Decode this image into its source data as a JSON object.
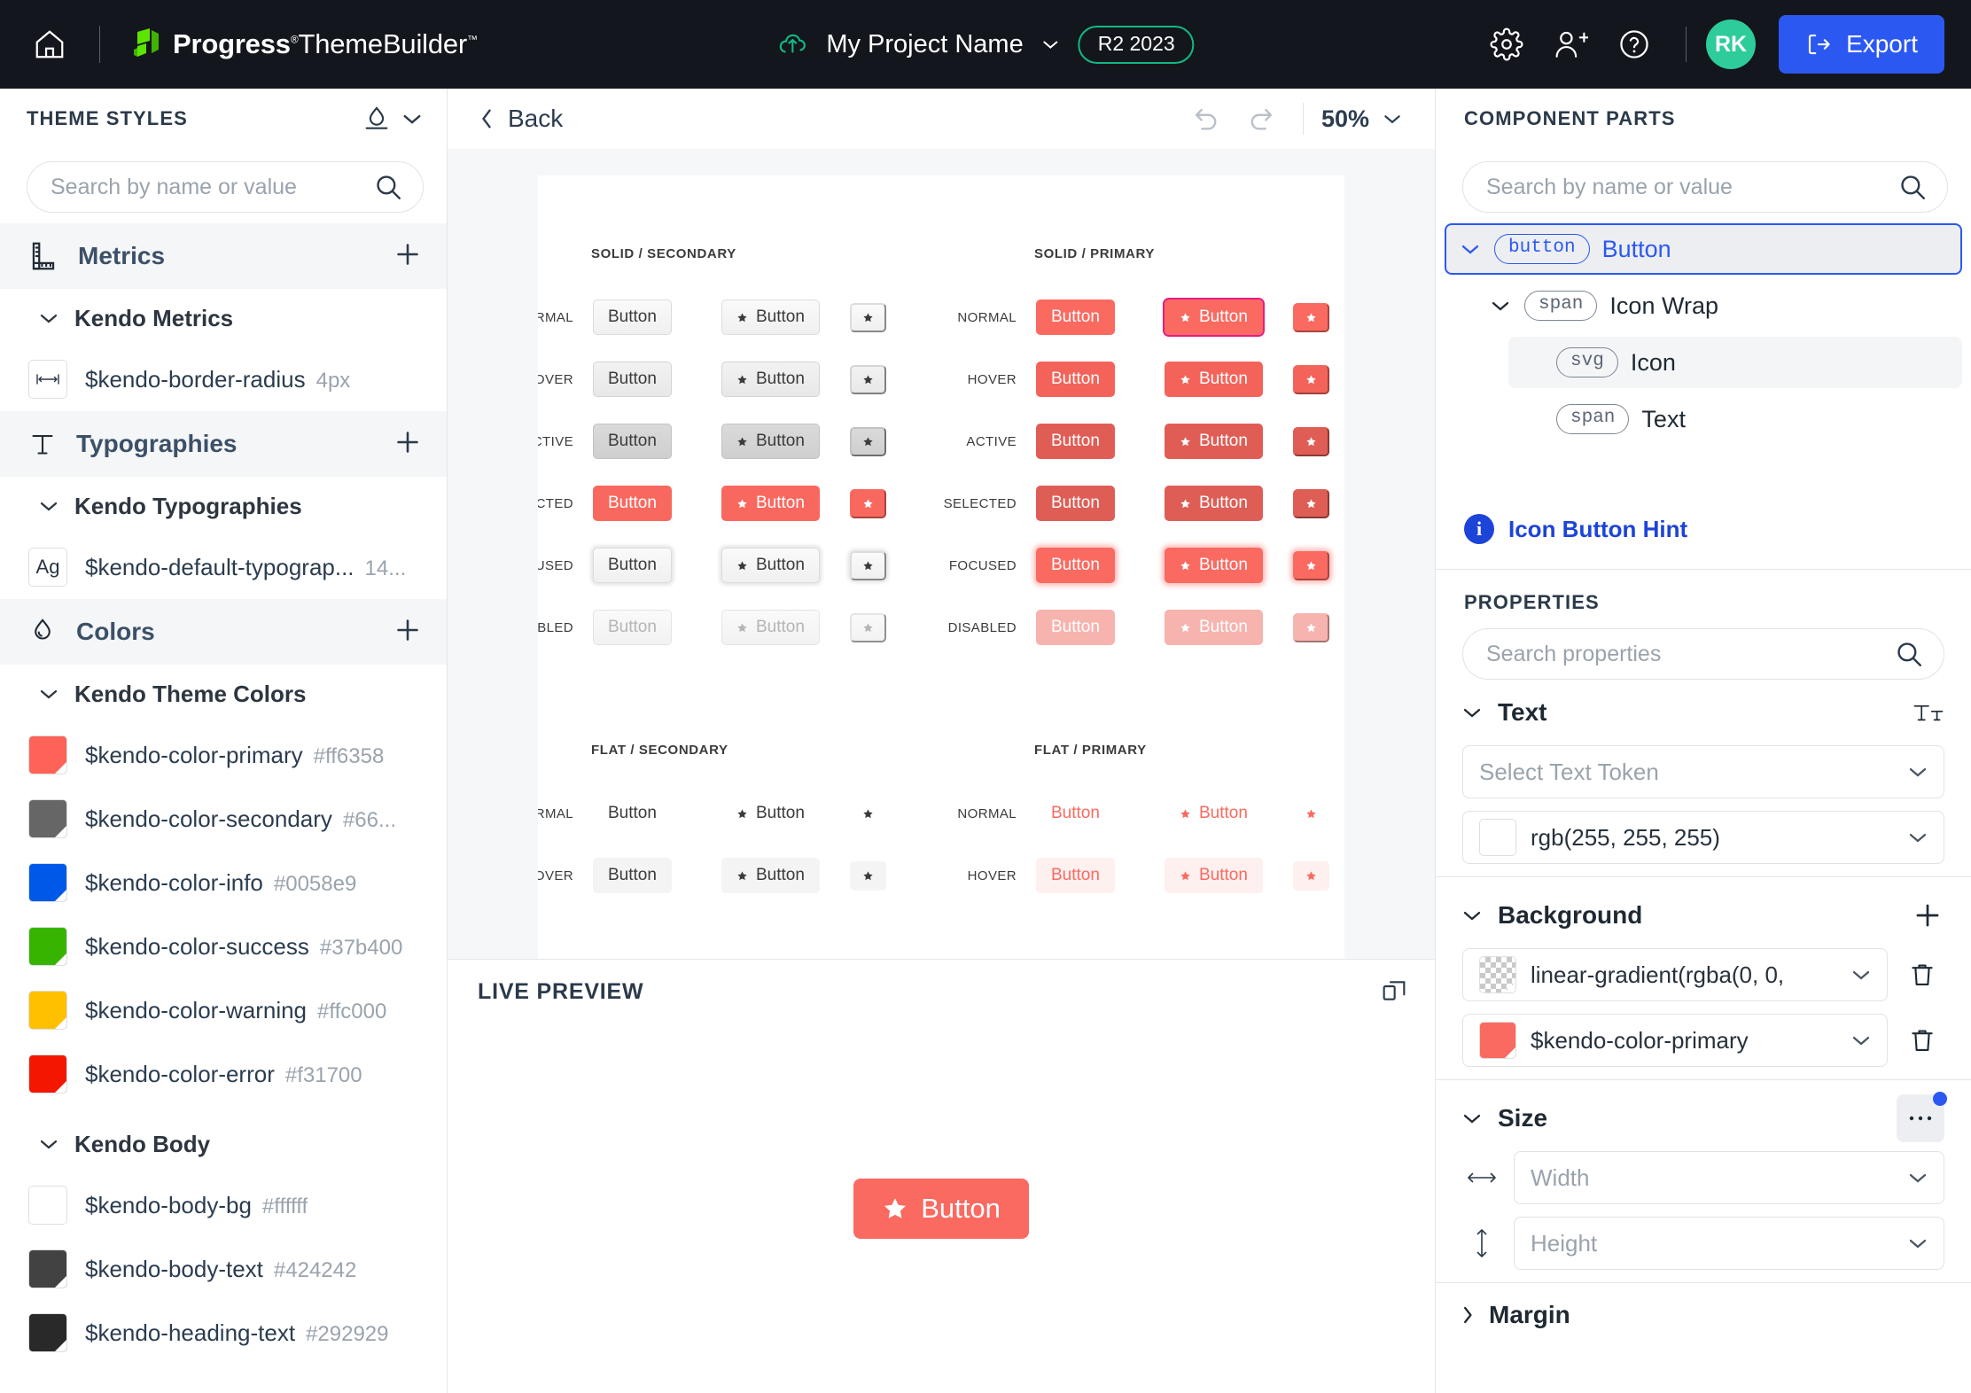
{
  "topbar": {
    "home_icon": "home-icon",
    "brand_progress": "Progress",
    "brand_theme": "ThemeBuilder",
    "project_name": "My Project Name",
    "release_badge": "R2 2023",
    "settings_icon": "gear-icon",
    "invite_icon": "add-user-icon",
    "help_icon": "help-icon",
    "avatar_initials": "RK",
    "export_label": "Export",
    "accent_blue": "#2c58f2",
    "accent_green": "#12b886",
    "avatar_bg": "#2ecc9b"
  },
  "left_panel": {
    "title": "THEME STYLES",
    "search_placeholder": "Search by name or value",
    "categories": [
      {
        "label": "Metrics",
        "icon": "ruler-icon"
      },
      {
        "label": "Typographies",
        "icon": "type-icon"
      },
      {
        "label": "Colors",
        "icon": "droplet-icon"
      }
    ],
    "groups": {
      "metrics": "Kendo Metrics",
      "typographies": "Kendo Typographies",
      "theme_colors": "Kendo Theme Colors",
      "body": "Kendo Body"
    },
    "metric_tokens": [
      {
        "name": "$kendo-border-radius",
        "value": "4px",
        "icon": "width-arrow-icon"
      }
    ],
    "typography_tokens": [
      {
        "name": "$kendo-default-typograp...",
        "value": "14...",
        "icon": "Ag"
      }
    ],
    "theme_colors": [
      {
        "name": "$kendo-color-primary",
        "value": "#ff6358",
        "swatch": "#ff6358"
      },
      {
        "name": "$kendo-color-secondary",
        "value": "#66...",
        "swatch": "#666666"
      },
      {
        "name": "$kendo-color-info",
        "value": "#0058e9",
        "swatch": "#0058e9"
      },
      {
        "name": "$kendo-color-success",
        "value": "#37b400",
        "swatch": "#37b400"
      },
      {
        "name": "$kendo-color-warning",
        "value": "#ffc000",
        "swatch": "#ffc000"
      },
      {
        "name": "$kendo-color-error",
        "value": "#f31700",
        "swatch": "#f31700"
      }
    ],
    "body_colors": [
      {
        "name": "$kendo-body-bg",
        "value": "#ffffff",
        "swatch": "#ffffff"
      },
      {
        "name": "$kendo-body-text",
        "value": "#424242",
        "swatch": "#424242"
      },
      {
        "name": "$kendo-heading-text",
        "value": "#292929",
        "swatch": "#292929"
      }
    ]
  },
  "center": {
    "back_label": "Back",
    "undo_icon": "undo-icon",
    "redo_icon": "redo-icon",
    "zoom_level": "50%",
    "sections": [
      {
        "title": "SOLID / SECONDARY"
      },
      {
        "title": "SOLID / PRIMARY"
      },
      {
        "title": "FLAT / SECONDARY"
      },
      {
        "title": "FLAT / PRIMARY"
      }
    ],
    "states": [
      "NORMAL",
      "HOVER",
      "ACTIVE",
      "SELECTED",
      "FOCUSED",
      "DISABLED"
    ],
    "flat_states": [
      "NORMAL",
      "HOVER"
    ],
    "button_label": "Button",
    "star_icon": "star-icon",
    "live_preview": {
      "title": "LIVE PREVIEW",
      "expand_icon": "open-in-new-icon",
      "button_label": "Button",
      "button_icon": "star-icon",
      "button_color": "#fa6a61"
    }
  },
  "right_panel": {
    "title": "COMPONENT PARTS",
    "search_placeholder": "Search by name or value",
    "tree": [
      {
        "tag": "button",
        "label": "Button",
        "depth": 0,
        "expanded": true,
        "selected": true
      },
      {
        "tag": "span",
        "label": "Icon Wrap",
        "depth": 1,
        "expanded": true,
        "selected": false
      },
      {
        "tag": "svg",
        "label": "Icon",
        "depth": 2,
        "expanded": false,
        "selected": false,
        "highlighted": true
      },
      {
        "tag": "span",
        "label": "Text",
        "depth": 2,
        "expanded": false,
        "selected": false
      }
    ],
    "hint": {
      "icon": "info-icon",
      "label": "Icon Button Hint"
    },
    "properties": {
      "title": "PROPERTIES",
      "search_placeholder": "Search properties",
      "sections": {
        "text": {
          "label": "Text",
          "action_icon": "font-size-icon",
          "token_placeholder": "Select Text Token",
          "color_value": "rgb(255, 255, 255)",
          "color_swatch": "#ffffff"
        },
        "background": {
          "label": "Background",
          "add_icon": "plus-icon",
          "layers": [
            {
              "value": "linear-gradient(rgba(0, 0,",
              "swatch": "checker",
              "delete_icon": "trash-icon"
            },
            {
              "value": "$kendo-color-primary",
              "swatch": "#fa6a61",
              "delete_icon": "trash-icon"
            }
          ]
        },
        "size": {
          "label": "Size",
          "more_icon": "ellipsis-icon",
          "width_placeholder": "Width",
          "height_placeholder": "Height",
          "width_icon": "horizontal-arrow-icon",
          "height_icon": "vertical-arrow-icon"
        },
        "margin": {
          "label": "Margin"
        }
      }
    }
  }
}
